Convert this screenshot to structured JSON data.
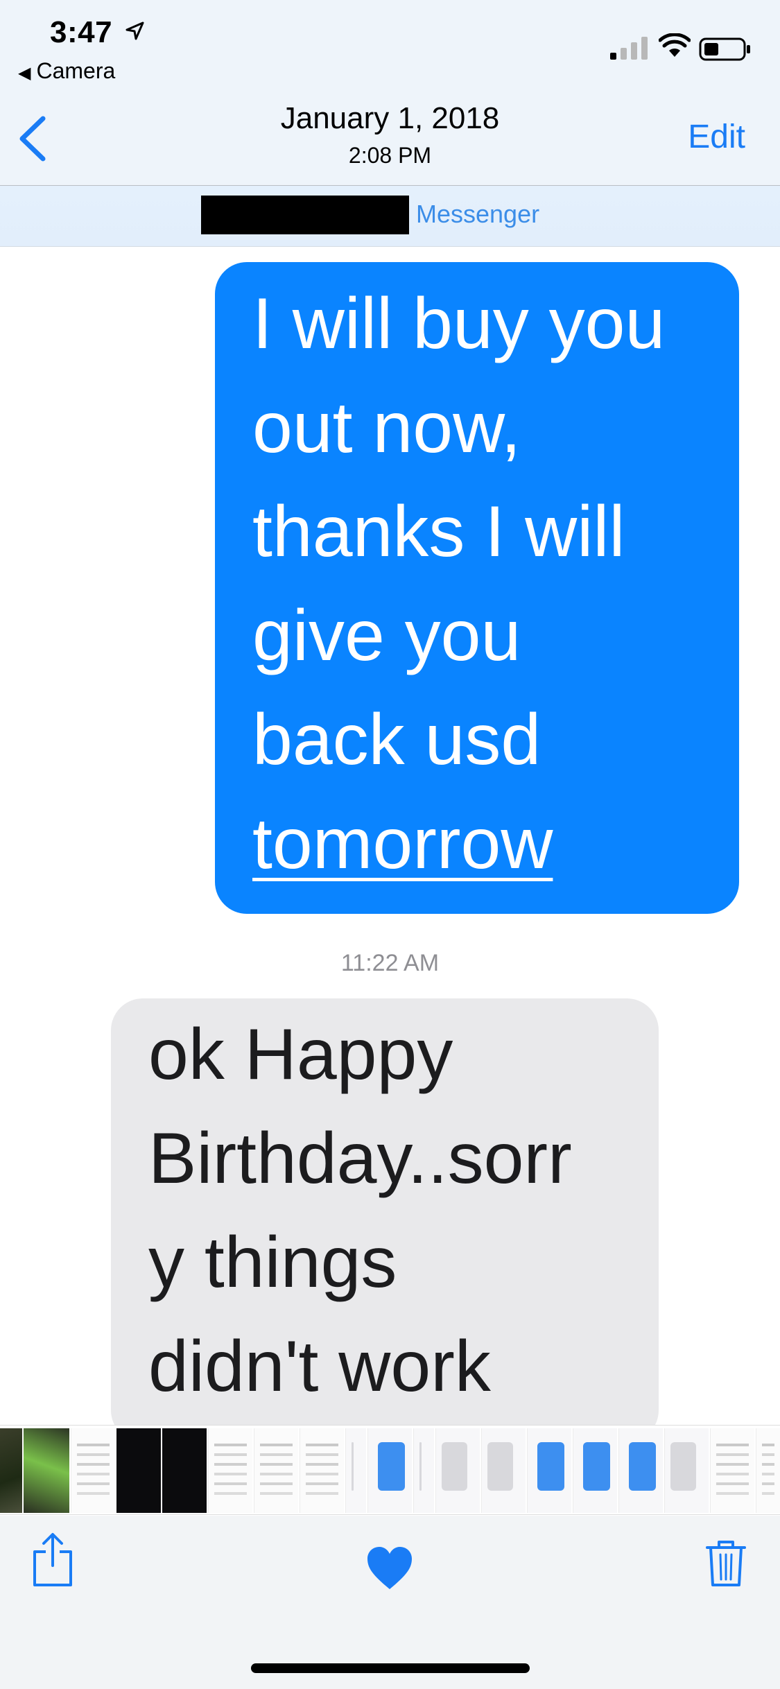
{
  "status_bar": {
    "time": "3:47",
    "back_app": "Camera",
    "location_icon": "location-arrow-icon",
    "signal_icon": "cellular-signal-icon",
    "wifi_icon": "wifi-icon",
    "battery_icon": "battery-icon"
  },
  "nav": {
    "back_icon": "chevron-left-icon",
    "date": "January 1, 2018",
    "time": "2:08 PM",
    "edit_label": "Edit"
  },
  "chat_header": {
    "service": "Messenger"
  },
  "messages": {
    "sent_1": {
      "lines": [
        "I will buy you",
        "out now,",
        "thanks I will",
        "give you",
        "back usd"
      ],
      "link_text": "tomorrow"
    },
    "timestamp": "11:22 AM",
    "received_1": {
      "lines": [
        "ok Happy",
        "Birthday..sorr",
        "y things",
        "didn't work"
      ]
    }
  },
  "toolbar": {
    "share_icon": "share-icon",
    "favorite_icon": "heart-icon",
    "delete_icon": "trash-icon"
  },
  "colors": {
    "accent": "#1a7cf5",
    "sent_bubble": "#0a84ff",
    "received_bubble": "#e9e9eb",
    "timestamp": "#8e8e93"
  }
}
